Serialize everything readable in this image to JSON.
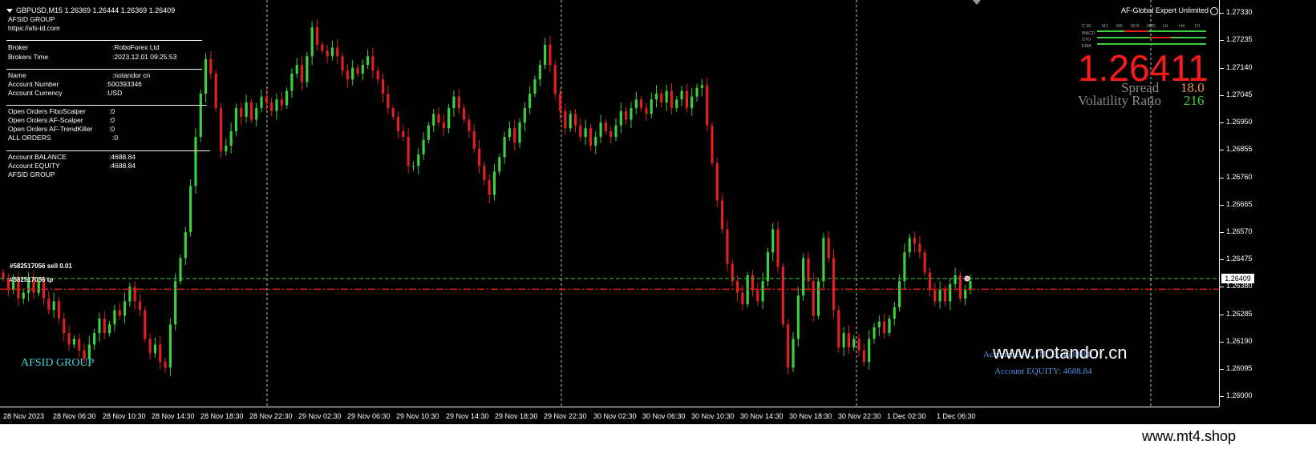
{
  "chart_header": "GBPUSD,M15  1.26369 1.26444 1.26369 1.26409",
  "info_panel": {
    "line1": "AFSID GROUP",
    "line2": "https://afs-id.com",
    "broker_label": "Broker",
    "broker_value": ":RoboForex Ltd",
    "time_label": "Brokers Time",
    "time_value": ":2023.12.01 09:25:53",
    "name_label": "Name",
    "name_value": ":notandor cn",
    "accnum_label": "Account Number",
    "accnum_value": ":500393346",
    "currency_label": "Account Currency",
    "currency_value": ":USD",
    "orders": [
      {
        "label": "Open Orders FiboScalper",
        "value": ":0"
      },
      {
        "label": "Open Orders AF-Scalper",
        "value": ":0"
      },
      {
        "label": "Open Orders AF-TrendKiller",
        "value": ":0"
      },
      {
        "label": "ALL ORDERS",
        "value": ":0"
      }
    ],
    "balance_label": "Account BALANCE",
    "balance_value": ":4688.84",
    "equity_label": "Account EQUITY",
    "equity_value": ":4688.84",
    "footer": "AFSID GROUP"
  },
  "ea_title": "AF-Global Expert Unlimited",
  "bid_price": "1.26411",
  "spread_label": "Spread",
  "spread_value": "18.0",
  "volatility_label": "Volatility Ratio",
  "volatility_value": "216",
  "mtf_panel": {
    "timeframes": [
      "M1",
      "M5",
      "M15",
      "M30",
      "H1",
      "H4",
      "D1"
    ],
    "rows": [
      "C 30",
      "MACD",
      "STO",
      "EMA"
    ]
  },
  "order_labels": {
    "sell": "#582517056 sell 0.01",
    "tp": "#582517056 tp"
  },
  "watermark_chart": "AFSID GROUP",
  "watermark_site": "www.notandor.cn",
  "watermark_overlap": "Account BALANCE: 4688.84",
  "account_equity_text": "Account EQUITY:  4688.84",
  "watermark_bottom": "www.mt4.shop",
  "price_axis": {
    "ticks": [
      "1.27330",
      "1.27235",
      "1.27140",
      "1.27045",
      "1.26950",
      "1.26855",
      "1.26760",
      "1.26665",
      "1.26570",
      "1.26475",
      "1.26380",
      "1.26285",
      "1.26190",
      "1.26095",
      "1.26000"
    ],
    "current_price": "1.26409"
  },
  "time_axis": [
    "28 Nov 2023",
    "28 Nov 06:30",
    "28 Nov 10:30",
    "28 Nov 14:30",
    "28 Nov 18:30",
    "28 Nov 22:30",
    "29 Nov 02:30",
    "29 Nov 06:30",
    "29 Nov 10:30",
    "29 Nov 14:30",
    "29 Nov 18:30",
    "29 Nov 22:30",
    "30 Nov 02:30",
    "30 Nov 06:30",
    "30 Nov 10:30",
    "30 Nov 14:30",
    "30 Nov 18:30",
    "30 Nov 22:30",
    "1 Dec 02:30",
    "1 Dec 06:30"
  ],
  "colors": {
    "bull": "#3ecf3e",
    "bear": "#e02020",
    "bid_line": "#3ecf3e",
    "tp_line": "#e02020",
    "spread": "#f0905a",
    "volatility": "#3ecf3e",
    "muted": "#8a8a8a",
    "watermark_cyan": "#45d0d8",
    "equity_blue": "#5a8fe8"
  },
  "chart_data": {
    "type": "candlestick",
    "symbol": "GBPUSD",
    "timeframe": "M15",
    "ylim": [
      1.26,
      1.2738
    ],
    "close": [
      1.2641,
      1.2637,
      1.264,
      1.2634,
      1.2636,
      1.2641,
      1.2636,
      1.264,
      1.2634,
      1.263,
      1.2633,
      1.2627,
      1.2622,
      1.2618,
      1.262,
      1.2616,
      1.2613,
      1.2618,
      1.2622,
      1.2627,
      1.2622,
      1.2625,
      1.263,
      1.2628,
      1.2633,
      1.2638,
      1.2633,
      1.263,
      1.262,
      1.2615,
      1.2618,
      1.2612,
      1.261,
      1.2625,
      1.264,
      1.2648,
      1.2657,
      1.2673,
      1.269,
      1.2705,
      1.2717,
      1.2712,
      1.27,
      1.2685,
      1.2687,
      1.2692,
      1.27,
      1.2697,
      1.2702,
      1.2696,
      1.27,
      1.2704,
      1.2702,
      1.2699,
      1.2703,
      1.2701,
      1.2706,
      1.2712,
      1.2715,
      1.2709,
      1.2718,
      1.2728,
      1.2722,
      1.272,
      1.2718,
      1.2721,
      1.2718,
      1.2713,
      1.271,
      1.2714,
      1.2712,
      1.2715,
      1.2718,
      1.2713,
      1.271,
      1.2705,
      1.27,
      1.2697,
      1.2692,
      1.269,
      1.268,
      1.268,
      1.2684,
      1.2689,
      1.2694,
      1.2698,
      1.2695,
      1.2693,
      1.27,
      1.2704,
      1.27,
      1.2696,
      1.2692,
      1.2686,
      1.268,
      1.2675,
      1.267,
      1.2678,
      1.2683,
      1.269,
      1.2693,
      1.2688,
      1.2695,
      1.27,
      1.2705,
      1.271,
      1.2715,
      1.2722,
      1.2715,
      1.2705,
      1.2699,
      1.2693,
      1.2698,
      1.2694,
      1.269,
      1.2693,
      1.2687,
      1.269,
      1.2695,
      1.2692,
      1.269,
      1.2694,
      1.2699,
      1.2696,
      1.27,
      1.2703,
      1.27,
      1.2698,
      1.2703,
      1.2705,
      1.2702,
      1.2706,
      1.27,
      1.2703,
      1.2706,
      1.27,
      1.2704,
      1.2707,
      1.2708,
      1.2694,
      1.2681,
      1.2668,
      1.2658,
      1.2646,
      1.264,
      1.2636,
      1.2632,
      1.2642,
      1.2637,
      1.2633,
      1.264,
      1.265,
      1.2658,
      1.2645,
      1.2625,
      1.261,
      1.262,
      1.2635,
      1.2648,
      1.264,
      1.2628,
      1.264,
      1.2655,
      1.2648,
      1.263,
      1.2617,
      1.2622,
      1.2617,
      1.262,
      1.2616,
      1.2612,
      1.262,
      1.2624,
      1.2626,
      1.2622,
      1.2627,
      1.2631,
      1.264,
      1.265,
      1.2655,
      1.2653,
      1.265,
      1.2643,
      1.2637,
      1.2633,
      1.2637,
      1.2633,
      1.2639,
      1.2642,
      1.2634,
      1.2637,
      1.264
    ]
  }
}
